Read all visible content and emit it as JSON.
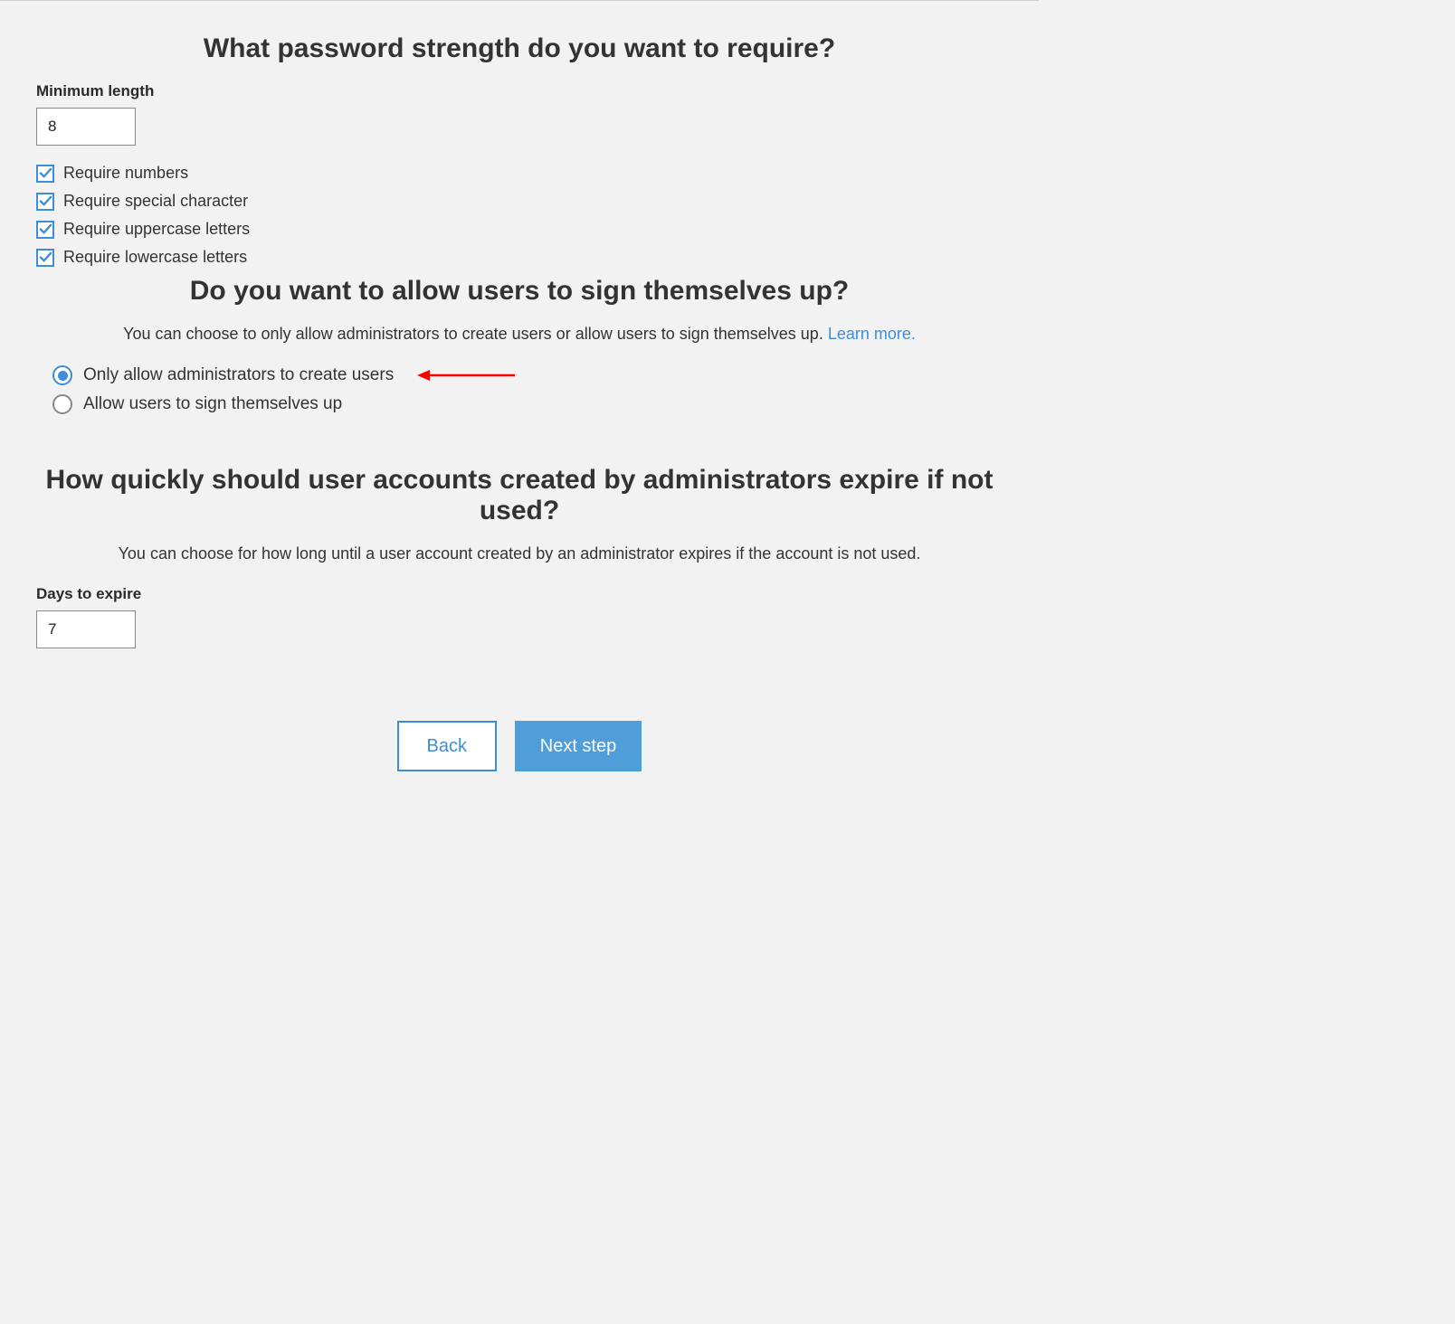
{
  "password_strength": {
    "heading": "What password strength do you want to require?",
    "min_length_label": "Minimum length",
    "min_length_value": "8",
    "checkboxes": [
      {
        "label": "Require numbers",
        "checked": true
      },
      {
        "label": "Require special character",
        "checked": true
      },
      {
        "label": "Require uppercase letters",
        "checked": true
      },
      {
        "label": "Require lowercase letters",
        "checked": true
      }
    ]
  },
  "self_signup": {
    "heading": "Do you want to allow users to sign themselves up?",
    "description_text": "You can choose to only allow administrators to create users or allow users to sign themselves up. ",
    "learn_more": "Learn more.",
    "options": [
      {
        "label": "Only allow administrators to create users",
        "selected": true
      },
      {
        "label": "Allow users to sign themselves up",
        "selected": false
      }
    ]
  },
  "expiration": {
    "heading": "How quickly should user accounts created by administrators expire if not used?",
    "description": "You can choose for how long until a user account created by an administrator expires if the account is not used.",
    "days_label": "Days to expire",
    "days_value": "7"
  },
  "buttons": {
    "back": "Back",
    "next": "Next step"
  }
}
